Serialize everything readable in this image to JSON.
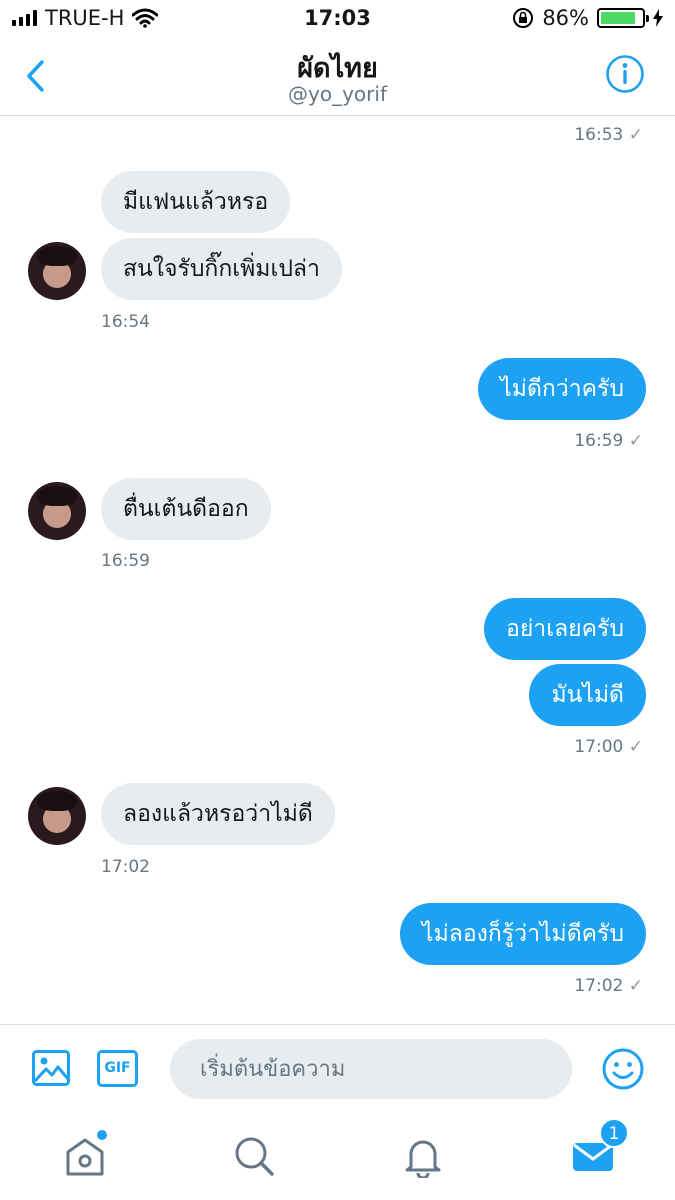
{
  "status_bar": {
    "carrier": "TRUE-H",
    "time": "17:03",
    "battery_percent_text": "86%",
    "battery_level": 0.86
  },
  "header": {
    "title": "ผัดไทย",
    "handle": "@yo_yorif"
  },
  "messages": [
    {
      "id": "t0",
      "type": "timestamp",
      "text": "16:53",
      "check": "✓"
    },
    {
      "id": "m1",
      "type": "in",
      "text": "มีแฟนแล้วหรอ"
    },
    {
      "id": "m2",
      "type": "in",
      "text": "สนใจรับกิ๊กเพิ่มเปล่า"
    },
    {
      "id": "t1",
      "type": "timestamp",
      "text": "16:54"
    },
    {
      "id": "m3",
      "type": "out",
      "text": "ไม่ดีกว่าครับ"
    },
    {
      "id": "t2",
      "type": "timestamp",
      "text": "16:59",
      "check": "✓"
    },
    {
      "id": "m4",
      "type": "in",
      "text": "ตื่นเต้นดีออก"
    },
    {
      "id": "t3",
      "type": "timestamp",
      "text": "16:59"
    },
    {
      "id": "m5",
      "type": "out",
      "text": "อย่าเลยครับ"
    },
    {
      "id": "m6",
      "type": "out",
      "text": "มันไม่ดี"
    },
    {
      "id": "t4",
      "type": "timestamp",
      "text": "17:00",
      "check": "✓"
    },
    {
      "id": "m7",
      "type": "in",
      "text": "ลองแล้วหรอว่าไม่ดี"
    },
    {
      "id": "t5",
      "type": "timestamp",
      "text": "17:02"
    },
    {
      "id": "m8",
      "type": "out",
      "text": "ไม่ลองก็รู้ว่าไม่ดีครับ"
    },
    {
      "id": "t6",
      "type": "timestamp",
      "text": "17:02",
      "check": "✓"
    }
  ],
  "composer": {
    "placeholder": "เริ่มต้นข้อความ",
    "gif_label": "GIF"
  },
  "tabbar": {
    "messages_badge": "1"
  },
  "colors": {
    "accent": "#1da1f2",
    "incoming_bubble": "#e6ecf0",
    "timestamp": "#657786"
  },
  "icons": [
    "back-chevron-icon",
    "info-icon",
    "image-icon",
    "gif-icon",
    "emoji-icon",
    "home-icon",
    "search-icon",
    "bell-icon",
    "mail-icon",
    "wifi-icon",
    "lock-rotation-icon",
    "charging-bolt-icon"
  ]
}
